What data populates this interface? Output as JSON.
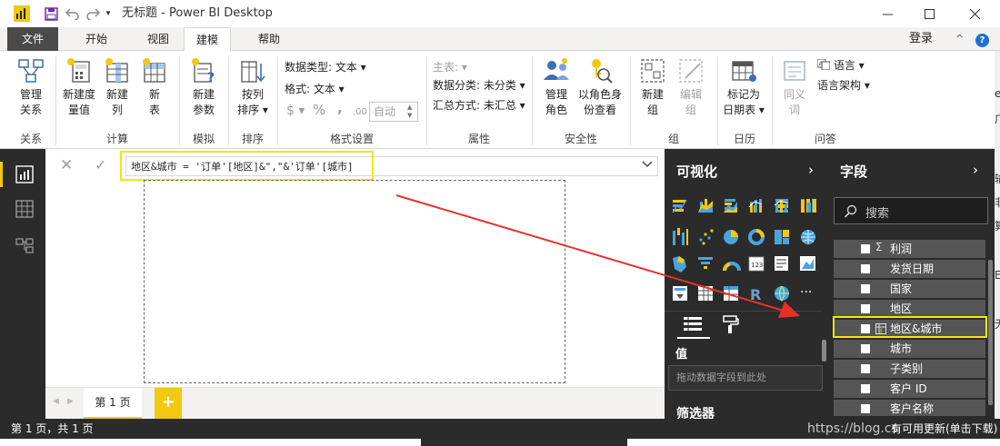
{
  "titlebar": {
    "title": "无标题 - Power BI Desktop",
    "dropdown_glyph": "▾"
  },
  "tabs": {
    "file": "文件",
    "home": "开始",
    "view": "视图",
    "modeling": "建模",
    "help": "帮助",
    "login": "登录",
    "collapse": "^",
    "help_icon": "?"
  },
  "ribbon": {
    "groups": {
      "relationships": "关系",
      "calculations": "计算",
      "whatif": "模拟",
      "sort": "排序",
      "formatting": "格式设置",
      "properties": "属性",
      "security": "安全性",
      "groups": "组",
      "calendars": "日历",
      "qa": "问答"
    },
    "buttons": {
      "manage_rel_1": "管理",
      "manage_rel_2": "关系",
      "new_measure_1": "新建度",
      "new_measure_2": "量值",
      "new_column_1": "新建",
      "new_column_2": "列",
      "new_table_1": "新",
      "new_table_2": "表",
      "new_param_1": "新建",
      "new_param_2": "参数",
      "sort_by_1": "按列",
      "sort_by_2": "排序 ▾",
      "manage_roles_1": "管理",
      "manage_roles_2": "角色",
      "view_as_1": "以角色身",
      "view_as_2": "份查看",
      "new_group_1": "新建",
      "new_group_2": "组",
      "edit_group_1": "编辑",
      "edit_group_2": "组",
      "mark_date_1": "标记为",
      "mark_date_2": "日期表 ▾",
      "synonyms_1": "同义",
      "synonyms_2": "词"
    },
    "formatting": {
      "data_type": "数据类型: 文本 ▾",
      "format": "格式: 文本 ▾",
      "currency": "$ ▾",
      "percent": "%",
      "comma": ",",
      "decimal": ".00",
      "auto": "自动"
    },
    "properties": {
      "home_table": "主表: ▾",
      "data_category": "数据分类: 未分类 ▾",
      "summarization": "汇总方式: 未汇总 ▾"
    },
    "qa": {
      "language": "语言 ▾",
      "linguistic_schema": "语言架构 ▾"
    }
  },
  "formula": {
    "cancel": "✕",
    "commit": "✓",
    "expression": "地区&城市 = '订单'[地区]&\",\"&'订单'[城市]",
    "expand": "⌄"
  },
  "pages": {
    "prev": "◀",
    "next": "▶",
    "page1": "第 1 页",
    "add": "+"
  },
  "status": {
    "text": "第 1 页，共 1 页",
    "watermark": "https://blog.cs",
    "watermark2": "有可用更新(单击下载)"
  },
  "viz_pane": {
    "title": "可视化",
    "chevron": "›",
    "values_label": "值",
    "drop_hint": "拖动数据字段到此处",
    "filters_label": "筛选器",
    "more_glyph": "···",
    "r_glyph": "R"
  },
  "fields_pane": {
    "title": "字段",
    "chevron": "›",
    "search_placeholder": "搜索",
    "sigma": "Σ",
    "fields": [
      {
        "label": "利润",
        "kind": "sum"
      },
      {
        "label": "发货日期",
        "kind": "plain"
      },
      {
        "label": "国家",
        "kind": "plain"
      },
      {
        "label": "地区",
        "kind": "plain"
      },
      {
        "label": "地区&城市",
        "kind": "calc"
      },
      {
        "label": "城市",
        "kind": "plain"
      },
      {
        "label": "子类别",
        "kind": "plain"
      },
      {
        "label": "客户 ID",
        "kind": "plain"
      },
      {
        "label": "客户名称",
        "kind": "plain"
      }
    ]
  },
  "edge_fragments": [
    "e",
    "广",
    "输",
    "非",
    "算",
    "E",
    "无"
  ],
  "colors": {
    "accent_yellow": "#f2c811",
    "highlight_yellow": "#f5e60a",
    "arrow_red": "#e8302a",
    "dark_pane": "#2b2b2b",
    "field_row": "#555555"
  }
}
